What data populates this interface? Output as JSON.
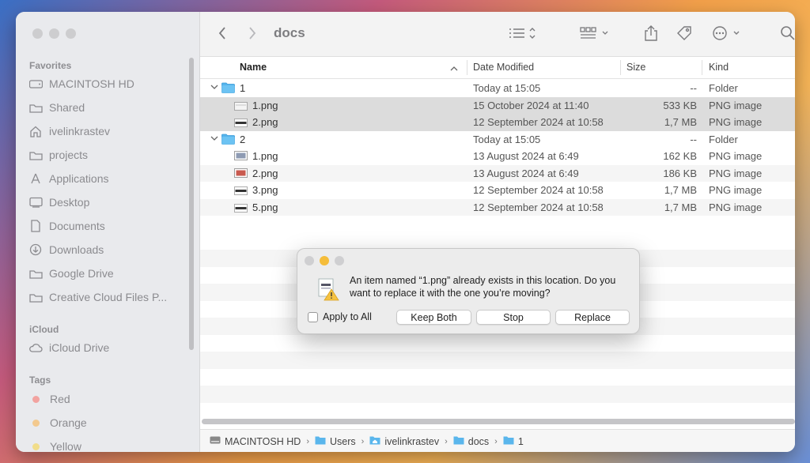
{
  "sidebar": {
    "favorites_header": "Favorites",
    "favorites": [
      {
        "label": "MACINTOSH HD",
        "icon": "hard-drive-icon"
      },
      {
        "label": "Shared",
        "icon": "folder-icon"
      },
      {
        "label": "ivelinkrastev",
        "icon": "home-icon"
      },
      {
        "label": "projects",
        "icon": "folder-icon"
      },
      {
        "label": "Applications",
        "icon": "applications-icon"
      },
      {
        "label": "Desktop",
        "icon": "desktop-icon"
      },
      {
        "label": "Documents",
        "icon": "document-icon"
      },
      {
        "label": "Downloads",
        "icon": "download-icon"
      },
      {
        "label": "Google Drive",
        "icon": "folder-icon"
      },
      {
        "label": "Creative Cloud Files P...",
        "icon": "folder-icon"
      }
    ],
    "icloud_header": "iCloud",
    "icloud": [
      {
        "label": "iCloud Drive",
        "icon": "cloud-icon"
      }
    ],
    "tags_header": "Tags",
    "tags": [
      {
        "label": "Red",
        "color": "#f2a3a0"
      },
      {
        "label": "Orange",
        "color": "#f3c98e"
      },
      {
        "label": "Yellow",
        "color": "#f1dd8a"
      }
    ]
  },
  "toolbar": {
    "title": "docs",
    "icons": [
      "back-icon",
      "forward-icon",
      "list-view-icon",
      "group-icon",
      "share-icon",
      "tag-icon",
      "more-icon",
      "search-icon"
    ]
  },
  "columns": {
    "name": "Name",
    "date": "Date Modified",
    "size": "Size",
    "kind": "Kind"
  },
  "rows": [
    {
      "name": "1",
      "date": "Today at 15:05",
      "size": "--",
      "kind": "Folder",
      "type": "folder"
    },
    {
      "name": "1.png",
      "date": "15 October 2024 at 11:40",
      "size": "533 KB",
      "kind": "PNG image",
      "type": "png-light"
    },
    {
      "name": "2.png",
      "date": "12 September 2024 at 10:58",
      "size": "1,7 MB",
      "kind": "PNG image",
      "type": "png-dark"
    },
    {
      "name": "2",
      "date": "Today at 15:05",
      "size": "--",
      "kind": "Folder",
      "type": "folder"
    },
    {
      "name": "1.png",
      "date": "13 August 2024 at 6:49",
      "size": "162 KB",
      "kind": "PNG image",
      "type": "png-gray"
    },
    {
      "name": "2.png",
      "date": "13 August 2024 at 6:49",
      "size": "186 KB",
      "kind": "PNG image",
      "type": "png-red"
    },
    {
      "name": "3.png",
      "date": "12 September 2024 at 10:58",
      "size": "1,7 MB",
      "kind": "PNG image",
      "type": "png-dark"
    },
    {
      "name": "5.png",
      "date": "12 September 2024 at 10:58",
      "size": "1,7 MB",
      "kind": "PNG image",
      "type": "png-dark"
    }
  ],
  "pathbar": [
    "MACINTOSH HD",
    "Users",
    "ivelinkrastev",
    "docs",
    "1"
  ],
  "dialog": {
    "message": "An item named “1.png” already exists in this location. Do you want to replace it with the one you’re moving?",
    "apply_all": "Apply to All",
    "keep_both": "Keep Both",
    "stop": "Stop",
    "replace": "Replace"
  }
}
